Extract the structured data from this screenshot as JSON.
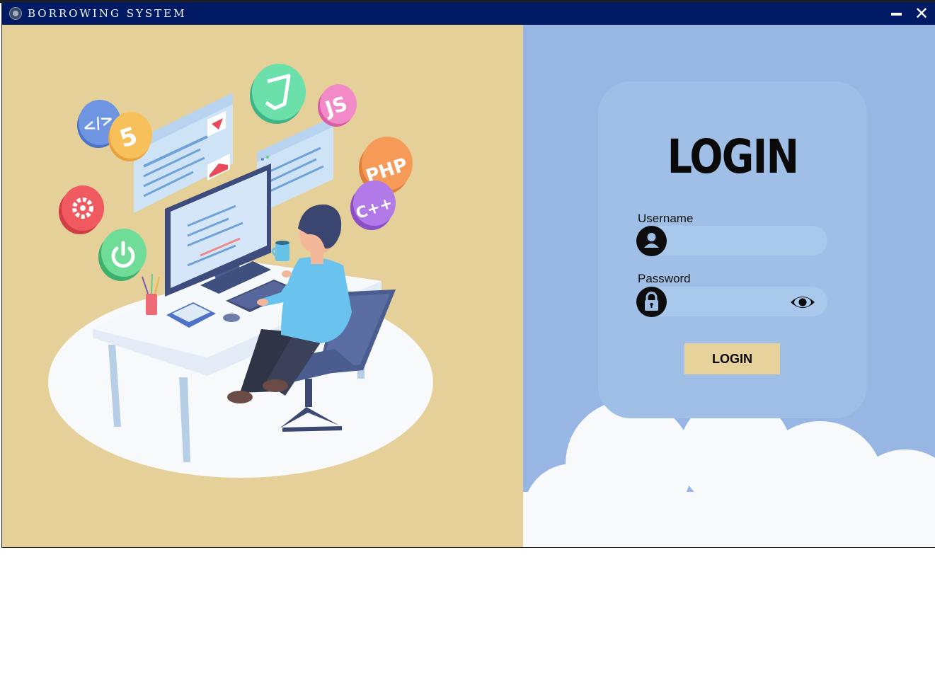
{
  "window": {
    "title": "BORROWING SYSTEM",
    "close_glyph": "✕"
  },
  "login": {
    "heading": "LOGIN",
    "username_label": "Username",
    "username_value": "",
    "password_label": "Password",
    "password_value": "",
    "submit_label": "LOGIN"
  },
  "illustration": {
    "badges": [
      "</>",
      "5",
      "JS",
      "PHP",
      "C++"
    ]
  },
  "icons": {
    "app": "app-logo-icon",
    "minimize": "minimize-icon",
    "close": "close-icon",
    "user": "user-icon",
    "lock": "lock-icon",
    "eye": "eye-icon"
  },
  "colors": {
    "titlebar": "#001b63",
    "left_background": "#e6d09a",
    "right_background": "#98b6e4",
    "card": "#a0bfe6",
    "input": "#a8c8ec",
    "button": "#e8d29c"
  }
}
